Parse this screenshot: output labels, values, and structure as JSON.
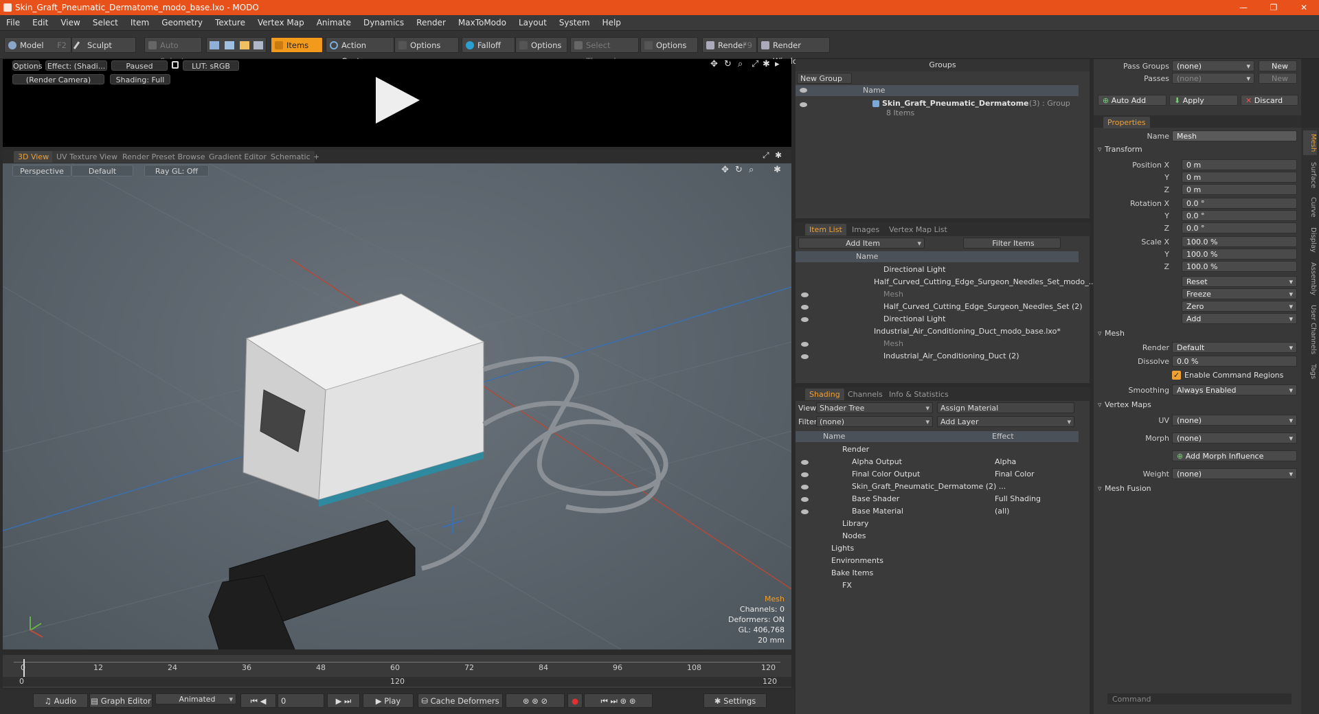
{
  "window": {
    "title": "Skin_Graft_Pneumatic_Dermatome_modo_base.lxo - MODO"
  },
  "menu": [
    "File",
    "Edit",
    "View",
    "Select",
    "Item",
    "Geometry",
    "Texture",
    "Vertex Map",
    "Animate",
    "Dynamics",
    "Render",
    "MaxToModo",
    "Layout",
    "System",
    "Help"
  ],
  "toolbar": {
    "model": "Model",
    "model_key": "F2",
    "sculpt": "Sculpt",
    "auto_select": "Auto Select",
    "items": "Items",
    "action_center": "Action Center",
    "options1": "Options",
    "falloff": "Falloff",
    "options2": "Options",
    "select_through": "Select Through",
    "options3": "Options",
    "render": "Render",
    "render_key": "F9",
    "render_window": "Render Window"
  },
  "preview": {
    "options": "Options",
    "effect": "Effect: (Shadi...",
    "paused": "Paused",
    "lut": "LUT: sRGB",
    "camera": "(Render Camera)",
    "shading": "Shading: Full"
  },
  "viewport_tabs": [
    "3D View",
    "UV Texture View",
    "Render Preset Browser",
    "Gradient Editor",
    "Schematic"
  ],
  "viewport": {
    "perspective": "Perspective",
    "default": "Default",
    "raygl": "Ray GL: Off"
  },
  "hud": {
    "title": "Mesh",
    "channels": "Channels: 0",
    "deformers": "Deformers: ON",
    "gl": "GL: 406,768",
    "scale": "20 mm"
  },
  "timeline": {
    "ticks": [
      "0",
      "12",
      "24",
      "36",
      "48",
      "60",
      "72",
      "84",
      "96",
      "108",
      "120"
    ],
    "start": "0",
    "mid": "120",
    "end": "120"
  },
  "bottom": {
    "audio": "Audio",
    "graph_editor": "Graph Editor",
    "animated": "Animated",
    "frame": "0",
    "play": "Play",
    "cache": "Cache Deformers",
    "settings": "Settings"
  },
  "groups": {
    "title": "Groups",
    "new_group": "New Group",
    "col_name": "Name",
    "item_name": "Skin_Graft_Pneumatic_Dermatome",
    "item_suffix": "(3) : Group",
    "item_count": "8 Items"
  },
  "item_list": {
    "tabs": [
      "Item List",
      "Images",
      "Vertex Map List"
    ],
    "add_item": "Add Item",
    "filter": "Filter Items",
    "col_name": "Name",
    "rows": [
      "Directional Light",
      "Half_Curved_Cutting_Edge_Surgeon_Needles_Set_modo_...",
      "Mesh",
      "Half_Curved_Cutting_Edge_Surgeon_Needles_Set (2)",
      "Directional Light",
      "Industrial_Air_Conditioning_Duct_modo_base.lxo*",
      "Mesh",
      "Industrial_Air_Conditioning_Duct (2)"
    ]
  },
  "shading": {
    "tabs": [
      "Shading",
      "Channels",
      "Info & Statistics"
    ],
    "view_label": "View",
    "view_value": "Shader Tree",
    "assign_material": "Assign Material",
    "filter_label": "Filter",
    "filter_value": "(none)",
    "add_layer": "Add Layer",
    "col_name": "Name",
    "col_effect": "Effect",
    "rows": [
      {
        "name": "Render",
        "effect": ""
      },
      {
        "name": "Alpha Output",
        "effect": "Alpha"
      },
      {
        "name": "Final Color Output",
        "effect": "Final Color"
      },
      {
        "name": "Skin_Graft_Pneumatic_Dermatome (2) ...",
        "effect": ""
      },
      {
        "name": "Base Shader",
        "effect": "Full Shading"
      },
      {
        "name": "Base Material",
        "effect": "(all)"
      },
      {
        "name": "Library",
        "effect": ""
      },
      {
        "name": "Nodes",
        "effect": ""
      },
      {
        "name": "Lights",
        "effect": ""
      },
      {
        "name": "Environments",
        "effect": ""
      },
      {
        "name": "Bake Items",
        "effect": ""
      },
      {
        "name": "FX",
        "effect": ""
      }
    ]
  },
  "properties": {
    "pass_groups": "Pass Groups",
    "pass_groups_value": "(none)",
    "new1": "New",
    "passes": "Passes",
    "passes_value": "(none)",
    "new2": "New",
    "auto_add": "Auto Add",
    "apply": "Apply",
    "discard": "Discard",
    "tab": "Properties",
    "name_label": "Name",
    "name_value": "Mesh",
    "transform": "Transform",
    "pos_x_label": "Position X",
    "pos_x": "0 m",
    "pos_y": "0 m",
    "pos_z": "0 m",
    "rot_x_label": "Rotation X",
    "rot_x": "0.0 °",
    "rot_y": "0.0 °",
    "rot_z": "0.0 °",
    "scale_x_label": "Scale X",
    "scale_x": "100.0 %",
    "scale_y": "100.0 %",
    "scale_z": "100.0 %",
    "y": "Y",
    "z": "Z",
    "reset": "Reset",
    "freeze": "Freeze",
    "zero": "Zero",
    "add": "Add",
    "mesh": "Mesh",
    "render_label": "Render",
    "render_value": "Default",
    "dissolve_label": "Dissolve",
    "dissolve_value": "0.0 %",
    "enable_cmd": "Enable Command Regions",
    "smoothing_label": "Smoothing",
    "smoothing_value": "Always Enabled",
    "vertex_maps": "Vertex Maps",
    "uv_label": "UV",
    "uv_value": "(none)",
    "morph_label": "Morph",
    "morph_value": "(none)",
    "add_morph": "Add Morph Influence",
    "weight_label": "Weight",
    "weight_value": "(none)",
    "mesh_fusion": "Mesh Fusion",
    "command_placeholder": "Command"
  },
  "side_tabs": [
    "Mesh",
    "Surface",
    "Curve",
    "Display",
    "Assembly",
    "User Channels",
    "Tags"
  ],
  "colors": {
    "accent": "#f0a030",
    "title": "#e8521a"
  }
}
